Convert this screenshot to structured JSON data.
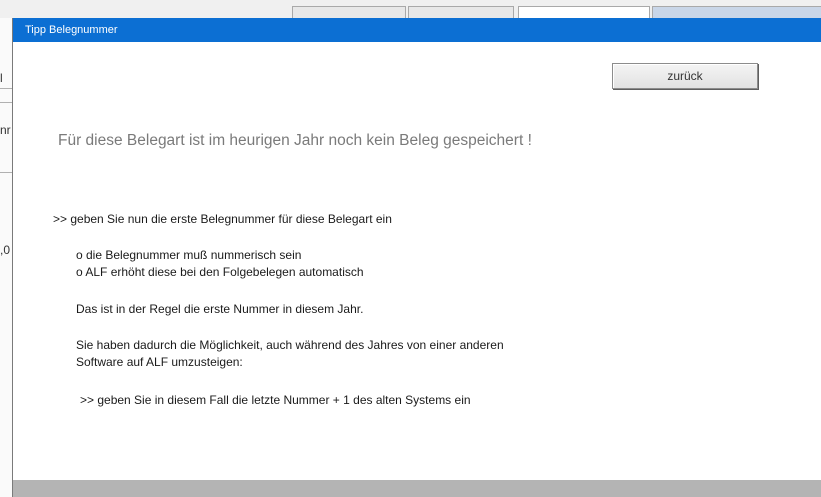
{
  "dialog": {
    "title": "Tipp Belegnummer",
    "back_button_label": "zurück",
    "headline": "Für diese Belegart ist im heurigen Jahr noch kein Beleg gespeichert !",
    "instruction_1": ">>  geben Sie nun die erste Belegnummer für diese Belegart ein",
    "bullet_1": "o  die Belegnummer muß nummerisch sein",
    "bullet_2": "o  ALF erhöht diese bei den Folgebelegen automatisch",
    "note": "Das ist in der Regel die erste Nummer in diesem Jahr.",
    "info_line_1": "Sie haben dadurch die Möglichkeit, auch während des Jahres von einer anderen",
    "info_line_2": "Software auf ALF umzusteigen:",
    "instruction_2": ">>  geben Sie in diesem Fall die letzte Nummer + 1 des alten Systems ein"
  },
  "background": {
    "frag_1": "l",
    "frag_2": "nr",
    "frag_3": ",0"
  },
  "colors": {
    "titlebar": "#0c6fd3",
    "headline_text": "#7a7a7a"
  }
}
